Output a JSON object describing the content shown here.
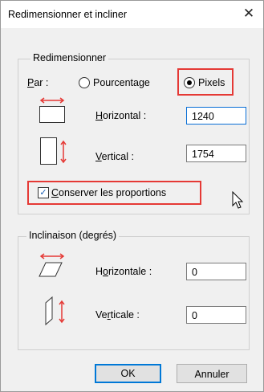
{
  "dialog": {
    "title": "Redimensionner et incliner"
  },
  "resize": {
    "legend": "Redimensionner",
    "by_label_letter": "P",
    "by_label_rest": "ar :",
    "option_percent": "Pourcentage",
    "option_pixels": "Pixels",
    "horizontal_letter": "H",
    "horizontal_rest": "orizontal :",
    "horizontal_value": "1240",
    "vertical_letter": "V",
    "vertical_rest": "ertical :",
    "vertical_value": "1754",
    "keep_letter": "C",
    "keep_rest": "onserver les proportions"
  },
  "skew": {
    "legend": "Inclinaison (degrés)",
    "horizontal_pre": "H",
    "horizontal_letter": "o",
    "horizontal_rest": "rizontale :",
    "horizontal_value": "0",
    "vertical_pre": "Ve",
    "vertical_letter": "r",
    "vertical_rest": "ticale :",
    "vertical_value": "0"
  },
  "buttons": {
    "ok": "OK",
    "cancel": "Annuler"
  }
}
